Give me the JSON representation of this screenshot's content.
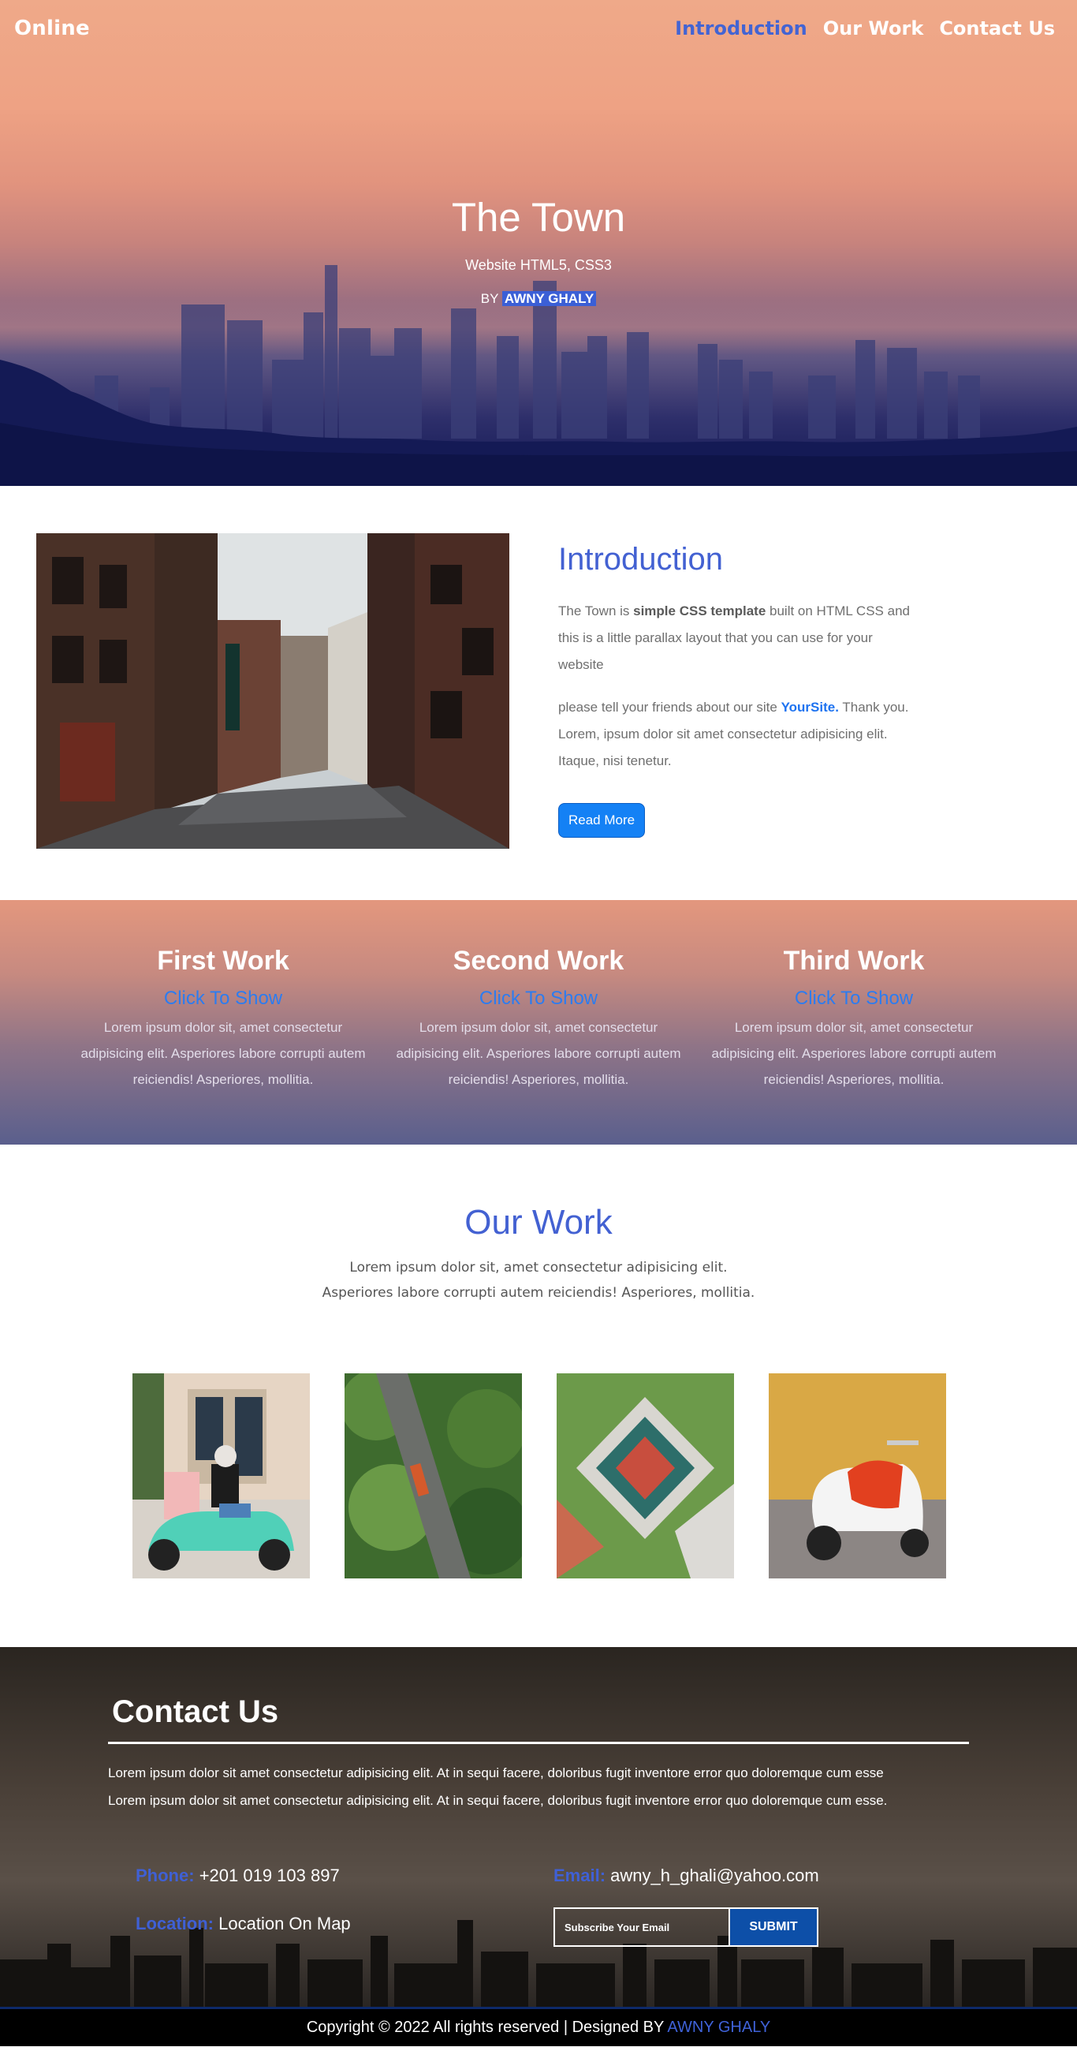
{
  "nav": {
    "logo": "Online",
    "links": [
      {
        "label": "Introduction",
        "active": true
      },
      {
        "label": "Our Work",
        "active": false
      },
      {
        "label": "Contact Us",
        "active": false
      }
    ]
  },
  "hero": {
    "title": "The Town",
    "subtitle": "Website HTML5, CSS3",
    "by_prefix": "BY",
    "by_name": "AWNY GHALY"
  },
  "intro": {
    "heading": "Introduction",
    "p1_a": "The Town is ",
    "p1_b": "simple CSS template",
    "p1_c": " built on HTML CSS and this is a little parallax layout that you can use for your website",
    "p2_a": "please tell your friends about our site ",
    "p2_b": "YourSite.",
    "p2_c": " Thank you. Lorem, ipsum dolor sit amet consectetur adipisicing elit. Itaque, nisi tenetur.",
    "button": "Read More",
    "image_alt": "street-photo"
  },
  "works": [
    {
      "title": "First Work",
      "link": "Click To Show",
      "text": "Lorem ipsum dolor sit, amet consectetur adipisicing elit. Asperiores labore corrupti autem reiciendis! Asperiores, mollitia."
    },
    {
      "title": "Second Work",
      "link": "Click To Show",
      "text": "Lorem ipsum dolor sit, amet consectetur adipisicing elit. Asperiores labore corrupti autem reiciendis! Asperiores, mollitia."
    },
    {
      "title": "Third Work",
      "link": "Click To Show",
      "text": "Lorem ipsum dolor sit, amet consectetur adipisicing elit. Asperiores labore corrupti autem reiciendis! Asperiores, mollitia."
    }
  ],
  "our_work": {
    "heading": "Our Work",
    "line1": "Lorem ipsum dolor sit, amet consectetur adipisicing elit.",
    "line2": "Asperiores labore corrupti autem reiciendis! Asperiores, mollitia."
  },
  "contact": {
    "heading": "Contact Us",
    "line1": "Lorem ipsum dolor sit amet consectetur adipisicing elit. At in sequi facere, doloribus fugit inventore error quo doloremque cum esse",
    "line2": "Lorem ipsum dolor sit amet consectetur adipisicing elit. At in sequi facere, doloribus fugit inventore error quo doloremque cum esse.",
    "phone_label": "Phone:",
    "phone": "+201 019 103 897",
    "email_label": "Email:",
    "email": "awny_h_ghali@yahoo.com",
    "location_label": "Location:",
    "location": "Location On Map",
    "subscribe_placeholder": "Subscribe Your Email",
    "submit": "SUBMIT"
  },
  "footer": {
    "text": "Copyright © 2022 All rights reserved | Designed BY ",
    "brand": "AWNY GHALY"
  },
  "colors": {
    "accent_blue": "#4361d2",
    "link_blue": "#2c7cf0",
    "button_blue": "#1481f5",
    "submit_blue": "#0d4fa8"
  }
}
